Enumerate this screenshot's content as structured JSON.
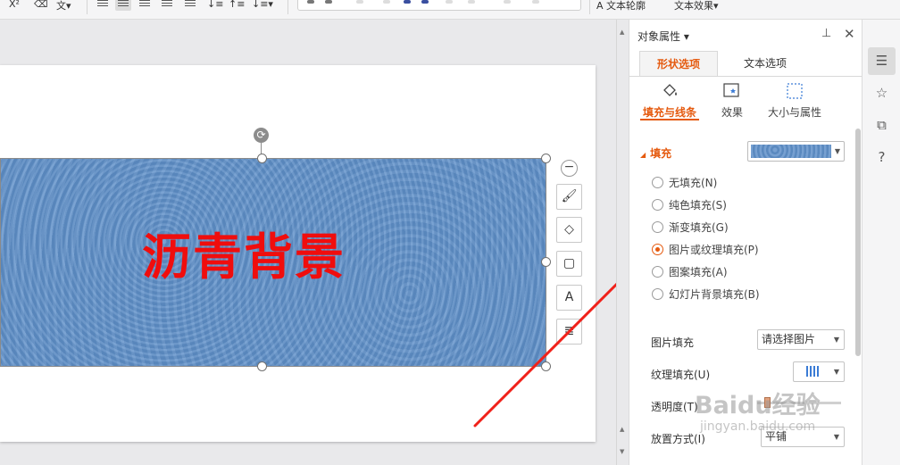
{
  "ribbon": {
    "text_outline_label": "文本轮廓",
    "text_effect_label": "文本效果"
  },
  "slide": {
    "shape_text": "沥青背景",
    "shape_fill_color": "#5f90c9",
    "text_color": "#f00d0d"
  },
  "panel": {
    "title": "对象属性",
    "tabs": [
      {
        "label": "形状选项",
        "active": true
      },
      {
        "label": "文本选项",
        "active": false
      }
    ],
    "subtabs": [
      {
        "label": "填充与线条",
        "icon": "fill-bucket-icon",
        "active": true
      },
      {
        "label": "效果",
        "icon": "effects-icon",
        "active": false
      },
      {
        "label": "大小与属性",
        "icon": "size-icon",
        "active": false
      }
    ],
    "fill": {
      "header": "填充",
      "options": [
        {
          "label": "无填充(N)",
          "checked": false
        },
        {
          "label": "纯色填充(S)",
          "checked": false
        },
        {
          "label": "渐变填充(G)",
          "checked": false
        },
        {
          "label": "图片或纹理填充(P)",
          "checked": true
        },
        {
          "label": "图案填充(A)",
          "checked": false
        },
        {
          "label": "幻灯片背景填充(B)",
          "checked": false
        }
      ]
    },
    "picture_fill": {
      "label": "图片填充",
      "value": "请选择图片"
    },
    "texture_fill": {
      "label": "纹理填充(U)"
    },
    "transparency": {
      "label": "透明度(T)",
      "value": 0.05
    },
    "placement": {
      "label": "放置方式(I)",
      "value": "平铺"
    }
  },
  "accent_color": "#e55a0f",
  "watermark": {
    "main": "Baidu经验",
    "sub": "jingyan.baidu.com"
  }
}
